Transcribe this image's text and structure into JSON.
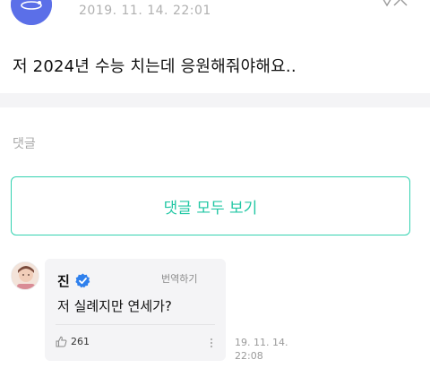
{
  "post": {
    "date": "2019. 11. 14. 22:01",
    "body": "저 2024년 수능 치는데 응원해줘야해요.."
  },
  "comments_section": {
    "label": "댓글",
    "view_all_label": "댓글 모두 보기"
  },
  "comment": {
    "author": "진",
    "translate_label": "번역하기",
    "text": "저 실례지만 연세가?",
    "like_count": "261",
    "timestamp_line1": "19. 11. 14.",
    "timestamp_line2": "22:08"
  },
  "colors": {
    "accent": "#22c7a4",
    "verified": "#2f80ed",
    "band": "#f4f4f6"
  },
  "icons": [
    "profile-avatar-icon",
    "translate-icon",
    "verified-badge-icon",
    "like-thumb-icon",
    "more-vertical-icon"
  ]
}
